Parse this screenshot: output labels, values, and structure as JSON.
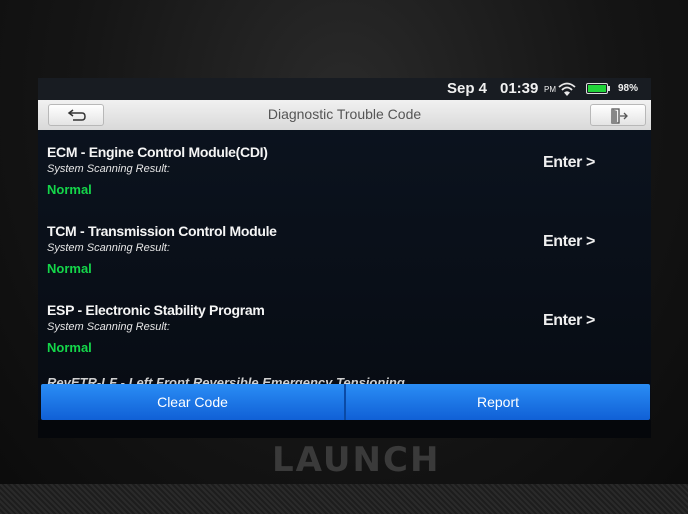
{
  "status_bar": {
    "date": "Sep 4",
    "time": "01:39",
    "ampm": "PM",
    "battery": "98%",
    "battery_level": 0.98,
    "wifi_icon": "wifi-icon",
    "battery_icon": "battery-icon"
  },
  "header": {
    "title": "Diagnostic Trouble Code",
    "back_icon": "back-arrow-icon",
    "exit_icon": "exit-icon"
  },
  "modules": [
    {
      "name": "ECM - Engine Control Module(CDI)",
      "scan_label": "System Scanning Result:",
      "status": "Normal",
      "action": "Enter >"
    },
    {
      "name": "TCM - Transmission Control Module",
      "scan_label": "System Scanning Result:",
      "status": "Normal",
      "action": "Enter >"
    },
    {
      "name": "ESP - Electronic Stability Program",
      "scan_label": "System Scanning Result:",
      "status": "Normal",
      "action": "Enter >"
    }
  ],
  "partial_item": "RevETR-LF - Left Front Reversible Emergency Tensioning",
  "buttons": {
    "clear": "Clear Code",
    "report": "Report"
  },
  "device": {
    "brand": "LAUNCH"
  },
  "colors": {
    "status_normal": "#14d64a",
    "button_blue": "#1a73e8",
    "title_bar": "#e6e6e6"
  }
}
